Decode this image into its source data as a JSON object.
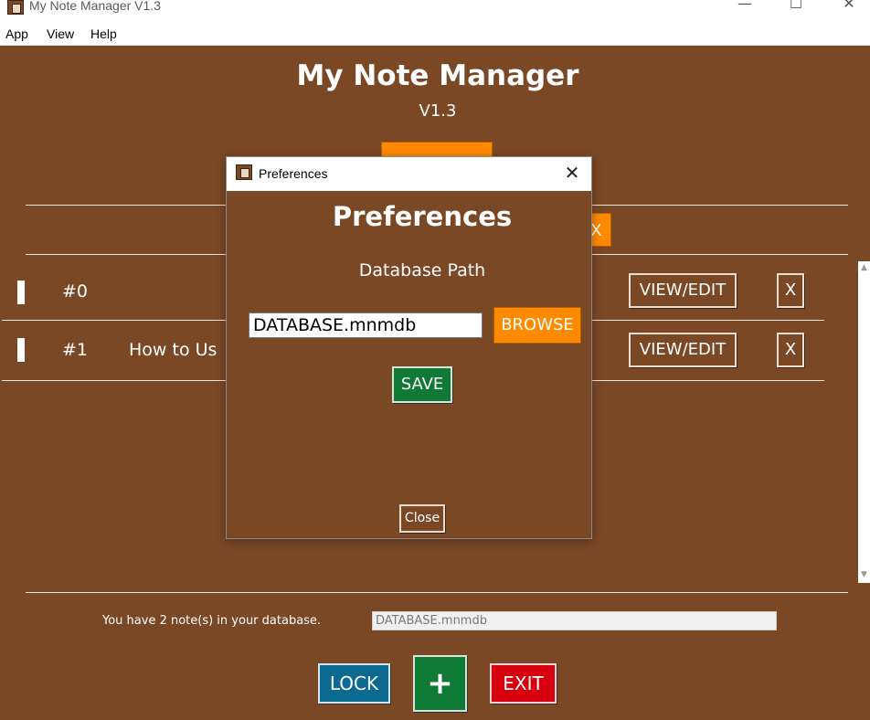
{
  "window": {
    "title": "My Note Manager V1.3",
    "minimize_glyph": "—",
    "maximize_glyph": "☐",
    "close_glyph": "✕"
  },
  "menu": {
    "items": [
      "App",
      "View",
      "Help"
    ]
  },
  "header": {
    "title": "My Note Manager",
    "version": "V1.3"
  },
  "toolbar": {
    "partial_button_label": "X"
  },
  "notes": [
    {
      "id": "#0",
      "title": "",
      "view_label": "VIEW/EDIT",
      "delete_label": "X"
    },
    {
      "id": "#1",
      "title": "How to Us",
      "view_label": "VIEW/EDIT",
      "delete_label": "X"
    }
  ],
  "scrollbar": {
    "up_arrow": "▲",
    "down_arrow": "▼"
  },
  "footer": {
    "status": "You have 2 note(s) in your database.",
    "database_path": "DATABASE.mnmdb",
    "lock_label": "LOCK",
    "add_label": "+",
    "exit_label": "EXIT"
  },
  "dialog": {
    "title": "Preferences",
    "close_glyph": "✕",
    "heading": "Preferences",
    "label": "Database Path",
    "path_value": "DATABASE.mnmdb",
    "browse_label": "BROWSE",
    "save_label": "SAVE",
    "close_label": "Close"
  },
  "colors": {
    "background": "#7b4826",
    "accent_orange": "#ff8a00",
    "save_green": "#0f7a35",
    "lock_blue": "#0a6a90",
    "exit_red": "#d6000f"
  }
}
